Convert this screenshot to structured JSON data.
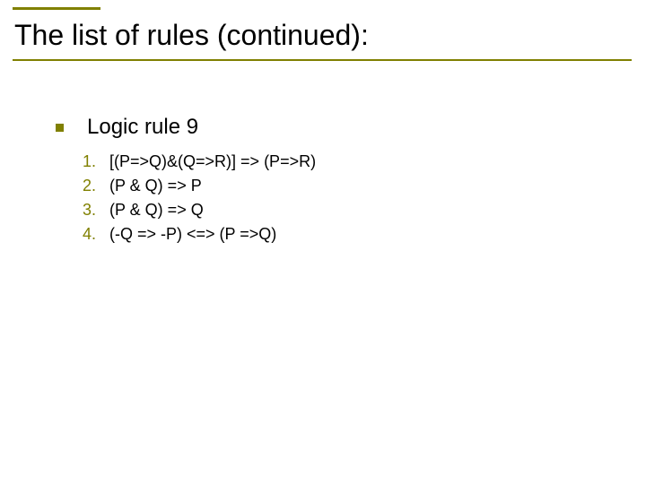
{
  "title": "The list of rules (continued):",
  "bullet": {
    "label": "Logic rule 9"
  },
  "rules": {
    "items": [
      {
        "num": "1.",
        "text": "[(P=>Q)&(Q=>R)]  => (P=>R)"
      },
      {
        "num": "2.",
        "text": "(P & Q) => P"
      },
      {
        "num": "3.",
        "text": "(P & Q) => Q"
      },
      {
        "num": "4.",
        "text": "(-Q => -P) <=> (P =>Q)"
      }
    ]
  },
  "colors": {
    "accent": "#808000"
  }
}
